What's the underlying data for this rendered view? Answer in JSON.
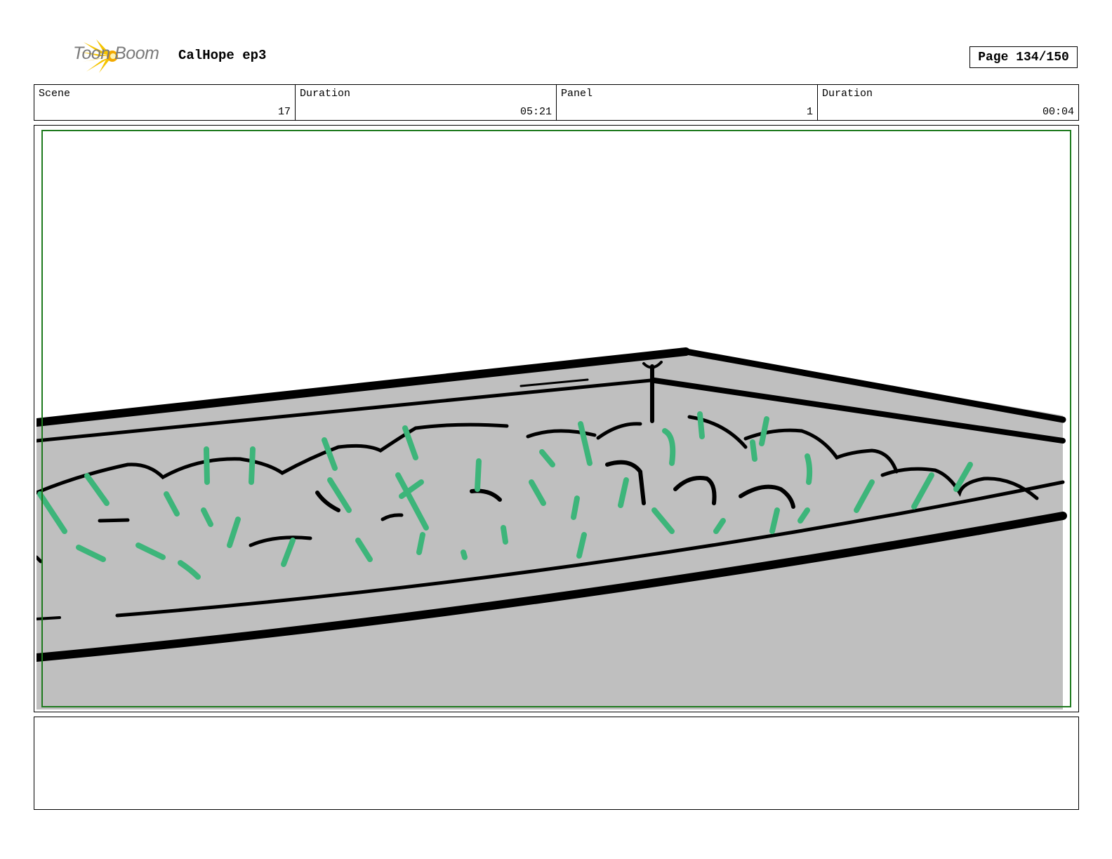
{
  "header": {
    "logo_text": "Toon Boom",
    "project_title": "CalHope ep3",
    "page_label": "Page 134/150"
  },
  "info": {
    "scene_label": "Scene",
    "scene_value": "17",
    "scene_duration_label": "Duration",
    "scene_duration_value": "05:21",
    "panel_label": "Panel",
    "panel_value": "1",
    "panel_duration_label": "Duration",
    "panel_duration_value": "00:04"
  },
  "panel": {
    "image": "planter-box-with-grass-sketch",
    "colors": {
      "fill": "#bfbfbf",
      "ink": "#000000",
      "grass": "#3db57a",
      "safe_frame": "#1e7a1e"
    }
  },
  "notes": {
    "text": ""
  }
}
